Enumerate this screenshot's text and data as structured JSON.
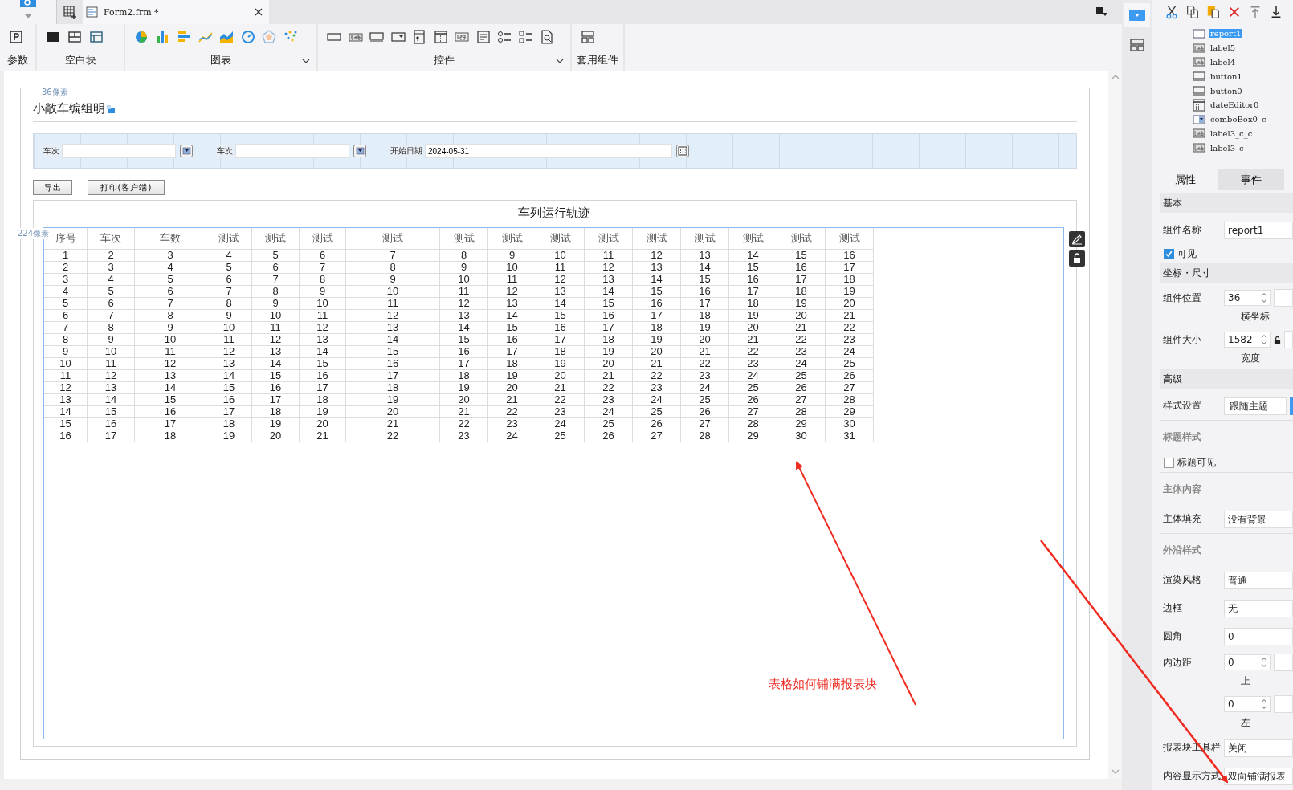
{
  "toolbar": {
    "tab": {
      "title": "Form2.frm *"
    },
    "groups": [
      {
        "kind": "params",
        "label": "参数",
        "expandable": false
      },
      {
        "kind": "blank",
        "label": "空白块",
        "expandable": false
      },
      {
        "kind": "chart",
        "label": "图表",
        "expandable": true
      },
      {
        "kind": "controls",
        "label": "控件",
        "expandable": true
      },
      {
        "kind": "template",
        "label": "套用组件",
        "expandable": false
      }
    ]
  },
  "form": {
    "ruler_top": "36像素",
    "title": "小敞车编组明",
    "filters": [
      {
        "kind": "combo",
        "label": "车次"
      },
      {
        "kind": "combo",
        "label": "车次"
      },
      {
        "kind": "date",
        "label": "开始日期",
        "value": "2024-05-31"
      }
    ],
    "buttons": [
      "导出",
      "打印(客户端)"
    ],
    "report": {
      "title": "车列运行轨迹",
      "ruler_left": "224像素",
      "columns": [
        "序号",
        "车次",
        "车数",
        "测试",
        "测试",
        "测试",
        "测试",
        "测试",
        "测试",
        "测试",
        "测试",
        "测试",
        "测试",
        "测试",
        "测试",
        "测试"
      ],
      "rows": [
        [
          "1",
          "2",
          "3",
          "4",
          "5",
          "6",
          "7",
          "8",
          "9",
          "10",
          "11",
          "12",
          "13",
          "14",
          "15",
          "16"
        ],
        [
          "2",
          "3",
          "4",
          "5",
          "6",
          "7",
          "8",
          "9",
          "10",
          "11",
          "12",
          "13",
          "14",
          "15",
          "16",
          "17"
        ],
        [
          "3",
          "4",
          "5",
          "6",
          "7",
          "8",
          "9",
          "10",
          "11",
          "12",
          "13",
          "14",
          "15",
          "16",
          "17",
          "18"
        ],
        [
          "4",
          "5",
          "6",
          "7",
          "8",
          "9",
          "10",
          "11",
          "12",
          "13",
          "14",
          "15",
          "16",
          "17",
          "18",
          "19"
        ],
        [
          "5",
          "6",
          "7",
          "8",
          "9",
          "10",
          "11",
          "12",
          "13",
          "14",
          "15",
          "16",
          "17",
          "18",
          "19",
          "20"
        ],
        [
          "6",
          "7",
          "8",
          "9",
          "10",
          "11",
          "12",
          "13",
          "14",
          "15",
          "16",
          "17",
          "18",
          "19",
          "20",
          "21"
        ],
        [
          "7",
          "8",
          "9",
          "10",
          "11",
          "12",
          "13",
          "14",
          "15",
          "16",
          "17",
          "18",
          "19",
          "20",
          "21",
          "22"
        ],
        [
          "8",
          "9",
          "10",
          "11",
          "12",
          "13",
          "14",
          "15",
          "16",
          "17",
          "18",
          "19",
          "20",
          "21",
          "22",
          "23"
        ],
        [
          "9",
          "10",
          "11",
          "12",
          "13",
          "14",
          "15",
          "16",
          "17",
          "18",
          "19",
          "20",
          "21",
          "22",
          "23",
          "24"
        ],
        [
          "10",
          "11",
          "12",
          "13",
          "14",
          "15",
          "16",
          "17",
          "18",
          "19",
          "20",
          "21",
          "22",
          "23",
          "24",
          "25"
        ],
        [
          "11",
          "12",
          "13",
          "14",
          "15",
          "16",
          "17",
          "18",
          "19",
          "20",
          "21",
          "22",
          "23",
          "24",
          "25",
          "26"
        ],
        [
          "12",
          "13",
          "14",
          "15",
          "16",
          "17",
          "18",
          "19",
          "20",
          "21",
          "22",
          "23",
          "24",
          "25",
          "26",
          "27"
        ],
        [
          "13",
          "14",
          "15",
          "16",
          "17",
          "18",
          "19",
          "20",
          "21",
          "22",
          "23",
          "24",
          "25",
          "26",
          "27",
          "28"
        ],
        [
          "14",
          "15",
          "16",
          "17",
          "18",
          "19",
          "20",
          "21",
          "22",
          "23",
          "24",
          "25",
          "26",
          "27",
          "28",
          "29"
        ],
        [
          "15",
          "16",
          "17",
          "18",
          "19",
          "20",
          "21",
          "22",
          "23",
          "24",
          "25",
          "26",
          "27",
          "28",
          "29",
          "30"
        ],
        [
          "16",
          "17",
          "18",
          "19",
          "20",
          "21",
          "22",
          "23",
          "24",
          "25",
          "26",
          "27",
          "28",
          "29",
          "30",
          "31"
        ]
      ]
    },
    "annotation": "表格如何铺满报表块"
  },
  "component_tree": [
    {
      "kind": "report",
      "name": "report1",
      "selected": true
    },
    {
      "kind": "label",
      "name": "label5",
      "selected": false
    },
    {
      "kind": "label",
      "name": "label4",
      "selected": false
    },
    {
      "kind": "button",
      "name": "button1",
      "selected": false
    },
    {
      "kind": "button",
      "name": "button0",
      "selected": false
    },
    {
      "kind": "date",
      "name": "dateEditor0",
      "selected": false
    },
    {
      "kind": "combo",
      "name": "comboBox0_c",
      "selected": false
    },
    {
      "kind": "label",
      "name": "label3_c_c",
      "selected": false
    },
    {
      "kind": "label",
      "name": "label3_c",
      "selected": false
    }
  ],
  "panel_tabs": [
    {
      "label": "属性",
      "selected": true
    },
    {
      "label": "事件",
      "selected": false
    }
  ],
  "properties": [
    {
      "kind": "section",
      "label": "基本"
    },
    {
      "kind": "text",
      "label": "组件名称",
      "value": "report1"
    },
    {
      "kind": "checkbox",
      "label": "可见",
      "checked": true
    },
    {
      "kind": "section",
      "label": "坐标・尺寸"
    },
    {
      "kind": "spinner",
      "label": "组件位置",
      "value": "36",
      "caption": "横坐标"
    },
    {
      "kind": "spinner",
      "label": "组件大小",
      "value": "1582",
      "caption": "宽度"
    },
    {
      "kind": "section",
      "label": "高级"
    },
    {
      "kind": "select",
      "label": "样式设置",
      "value": "跟随主题"
    },
    {
      "kind": "subsection",
      "label": "标题样式"
    },
    {
      "kind": "checkbox",
      "label": "标题可见",
      "checked": false
    },
    {
      "kind": "subsection",
      "label": "主体内容"
    },
    {
      "kind": "text",
      "label": "主体填充",
      "value": "没有背景"
    },
    {
      "kind": "subsection",
      "label": "外沿样式"
    },
    {
      "kind": "text",
      "label": "渲染风格",
      "value": "普通"
    },
    {
      "kind": "text",
      "label": "边框",
      "value": "无"
    },
    {
      "kind": "text",
      "label": "圆角",
      "value": "0"
    },
    {
      "kind": "spinner",
      "label": "内边距",
      "value": "0",
      "caption": "上"
    },
    {
      "kind": "spinner",
      "value": "0",
      "caption": "左"
    },
    {
      "kind": "text",
      "label": "报表块工具栏",
      "value": "关闭"
    },
    {
      "kind": "text",
      "label": "内容显示方式",
      "value": "双向铺满报表"
    }
  ]
}
